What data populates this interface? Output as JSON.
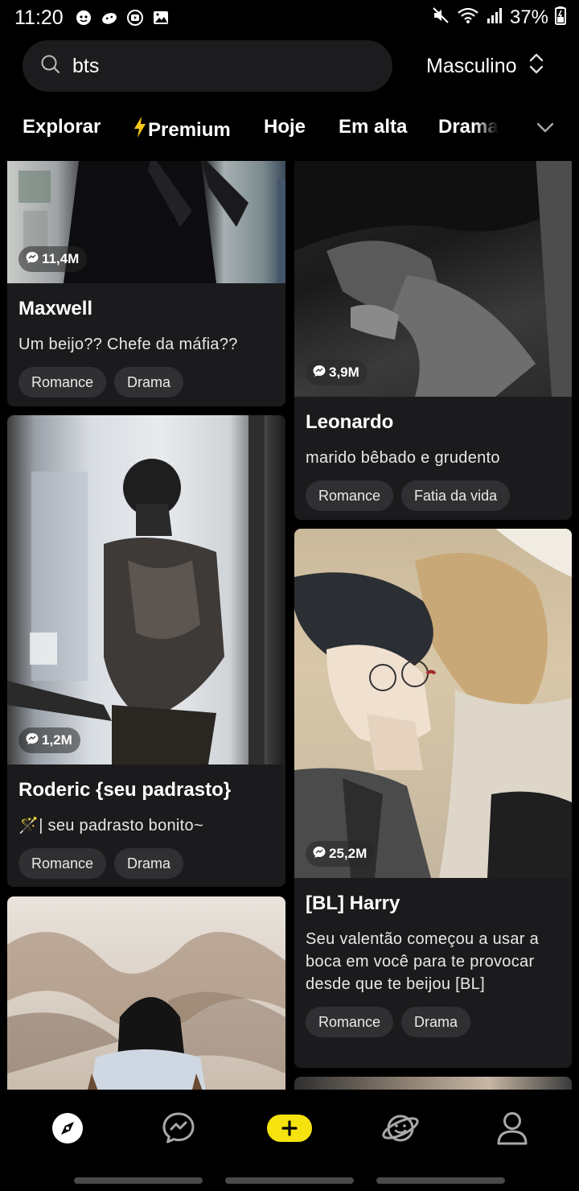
{
  "status_bar": {
    "time": "11:20",
    "battery": "37%"
  },
  "search": {
    "query": "bts",
    "icon": "search-icon"
  },
  "gender_filter": {
    "label": "Masculino"
  },
  "tabs": [
    {
      "label": "Explorar"
    },
    {
      "label": "Premium",
      "icon": "lightning-icon"
    },
    {
      "label": "Hoje"
    },
    {
      "label": "Em alta"
    },
    {
      "label": "Drama"
    }
  ],
  "cards": [
    {
      "title": "Maxwell",
      "desc": "Um beijo?? Chefe da máfia??",
      "views": "11,4M",
      "tags": [
        "Romance",
        "Drama"
      ]
    },
    {
      "title": "Leonardo",
      "desc": "marido bêbado e grudento",
      "views": "3,9M",
      "tags": [
        "Romance",
        "Fatia da vida"
      ]
    },
    {
      "title": "Roderic {seu padrasto}",
      "desc": "🪄| seu padrasto bonito~",
      "views": "1,2M",
      "tags": [
        "Romance",
        "Drama"
      ]
    },
    {
      "title": "[BL] Harry",
      "desc": "Seu valentão começou a usar a boca em você para te provocar desde que te beijou [BL]",
      "views": "25,2M",
      "tags": [
        "Romance",
        "Drama"
      ]
    }
  ],
  "bottom_nav": [
    {
      "icon": "explore-icon"
    },
    {
      "icon": "chat-icon"
    },
    {
      "icon": "create-icon"
    },
    {
      "icon": "planet-icon"
    },
    {
      "icon": "profile-icon"
    }
  ],
  "colors": {
    "accent": "#f5e20f",
    "card_bg": "#1b1b1d",
    "tag_bg": "#303033"
  }
}
